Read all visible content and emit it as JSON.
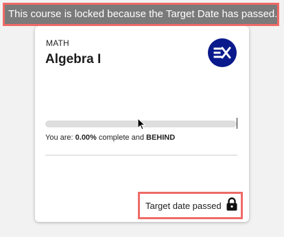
{
  "banner": {
    "message": "This course is locked because the Target Date has passed."
  },
  "course": {
    "subject": "MATH",
    "title": "Algebra I",
    "logo_icon": "ex-logo-icon",
    "logo_color": "#0a1a8c",
    "progress_fraction": 0.0,
    "status_prefix": "You are: ",
    "percent_complete": "0.00%",
    "status_middle": " complete and ",
    "pace_status": "BEHIND"
  },
  "lock": {
    "label": "Target date passed",
    "icon": "lock-icon"
  },
  "colors": {
    "highlight_border": "#ef6a66",
    "banner_bg": "#7a7a7a"
  }
}
